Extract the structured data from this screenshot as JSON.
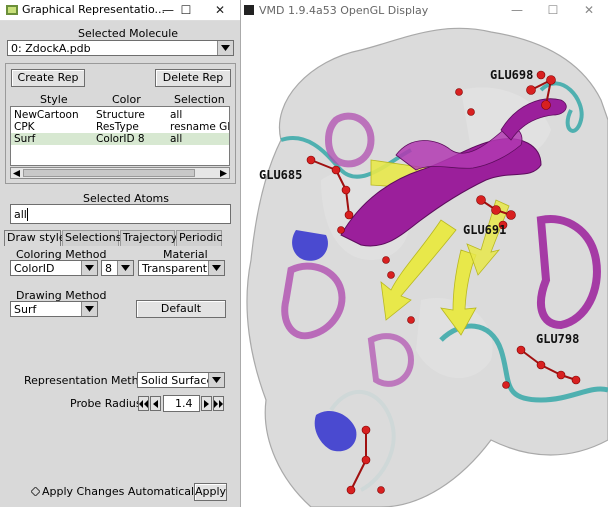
{
  "graphical_window": {
    "title": "Graphical Representatio...",
    "buttons": {
      "minimize": "—",
      "maximize": "☐",
      "close": "✕"
    },
    "selected_molecule_label": "Selected Molecule",
    "selected_molecule_value": "0: ZdockA.pdb",
    "create_rep": "Create Rep",
    "delete_rep": "Delete Rep",
    "rep_columns": [
      "Style",
      "Color",
      "Selection"
    ],
    "reps": [
      {
        "style": "NewCartoon",
        "color": "Structure",
        "selection": "all"
      },
      {
        "style": "CPK",
        "color": "ResType",
        "selection": "resname GLU"
      },
      {
        "style": "Surf",
        "color": "ColorID 8",
        "selection": "all"
      }
    ],
    "selected_atoms_label": "Selected Atoms",
    "selected_atoms_value": "all",
    "tabs": [
      "Draw style",
      "Selections",
      "Trajectory",
      "Periodic"
    ],
    "coloring_method_label": "Coloring Method",
    "coloring_method_value": "ColorID",
    "color_id_value": "8",
    "material_label": "Material",
    "material_value": "Transparent",
    "drawing_method_label": "Drawing Method",
    "drawing_method_value": "Surf",
    "default_button": "Default",
    "representation_method_label": "Representation Method",
    "representation_method_value": "Solid Surface",
    "probe_radius_label": "Probe Radius",
    "probe_radius_value": "1.4",
    "apply_auto_label": "Apply Changes Automatically",
    "apply_button": "Apply"
  },
  "gl_window": {
    "title": "VMD 1.9.4a53 OpenGL Display",
    "buttons": {
      "minimize": "—",
      "maximize": "☐",
      "close": "✕"
    },
    "residue_labels": [
      "GLU698",
      "GLU685",
      "GLU691",
      "GLU798"
    ]
  },
  "colors": {
    "helix": "#9b1f9b",
    "sheet": "#e8e84a",
    "coil": "#4fb0b0",
    "turn_blue": "#4a4ad0",
    "atoms": "#d82020",
    "surface": "#bdbdbd"
  }
}
